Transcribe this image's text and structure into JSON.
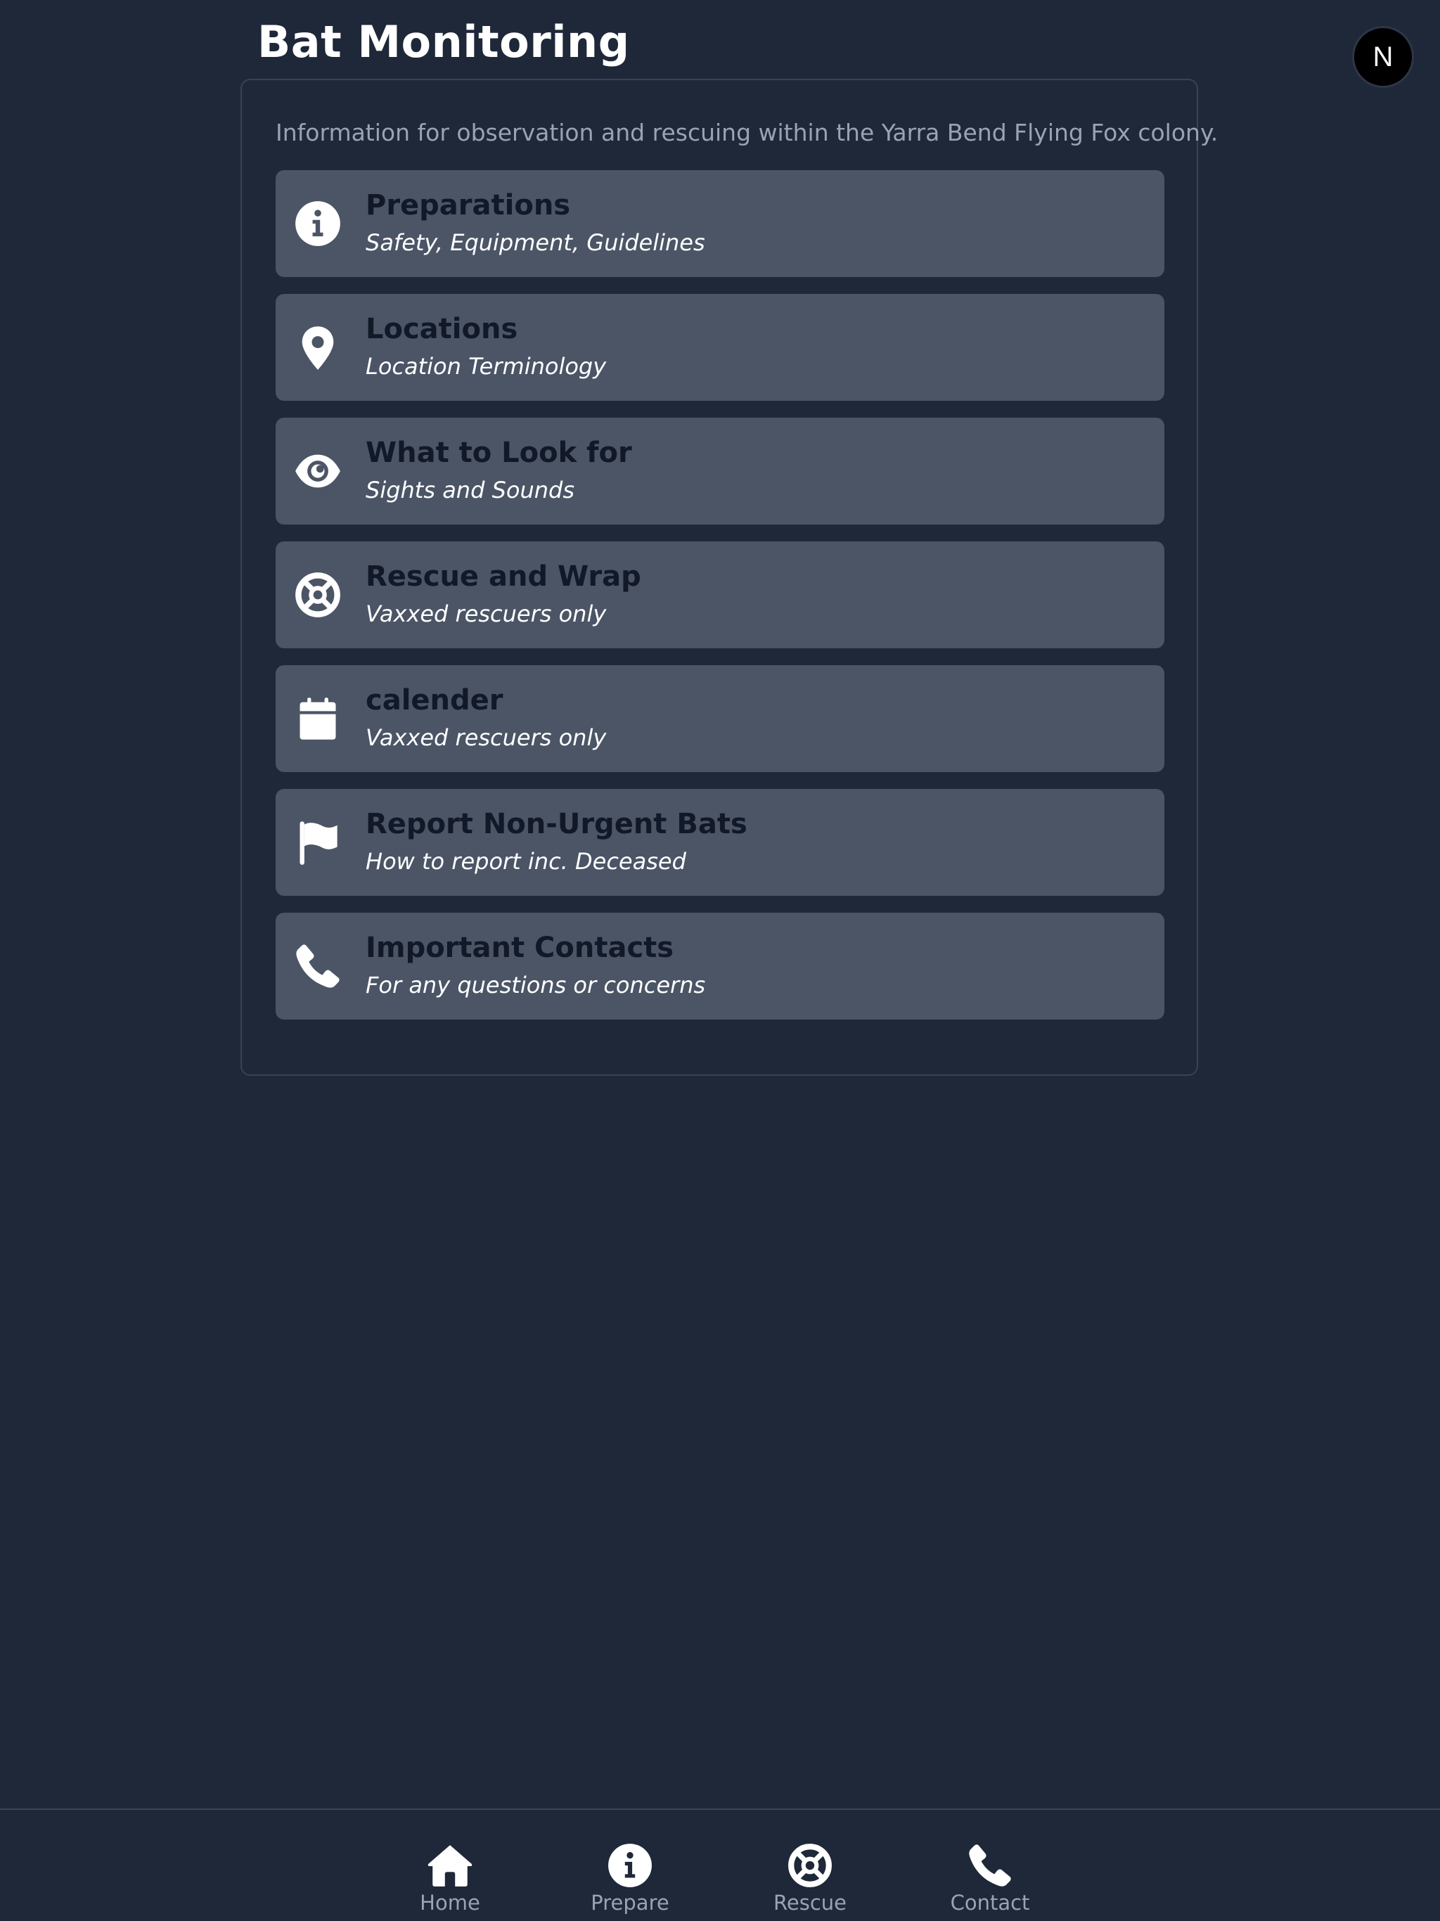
{
  "header": {
    "title": "Bat Monitoring",
    "badge_letter": "N"
  },
  "intro": "Information for observation and rescuing within the Yarra Bend Flying Fox colony.",
  "cards": [
    {
      "icon": "info-circle-icon",
      "title": "Preparations",
      "subtitle": "Safety, Equipment, Guidelines"
    },
    {
      "icon": "location-pin-icon",
      "title": "Locations",
      "subtitle": "Location Terminology"
    },
    {
      "icon": "eye-icon",
      "title": "What to Look for",
      "subtitle": "Sights and Sounds"
    },
    {
      "icon": "life-ring-icon",
      "title": "Rescue and Wrap",
      "subtitle": "Vaxxed rescuers only"
    },
    {
      "icon": "calendar-icon",
      "title": "calender",
      "subtitle": "Vaxxed rescuers only"
    },
    {
      "icon": "flag-icon",
      "title": "Report Non-Urgent Bats",
      "subtitle": "How to report inc. Deceased"
    },
    {
      "icon": "phone-icon",
      "title": "Important Contacts",
      "subtitle": "For any questions or concerns"
    }
  ],
  "bottom_nav": [
    {
      "icon": "home-icon",
      "label": "Home"
    },
    {
      "icon": "info-circle-icon",
      "label": "Prepare"
    },
    {
      "icon": "life-ring-icon",
      "label": "Rescue"
    },
    {
      "icon": "phone-icon",
      "label": "Contact"
    }
  ],
  "colors": {
    "background": "#1f2839",
    "card": "#4b5566",
    "card_title": "#111827",
    "muted_text": "#9aa3b2"
  }
}
